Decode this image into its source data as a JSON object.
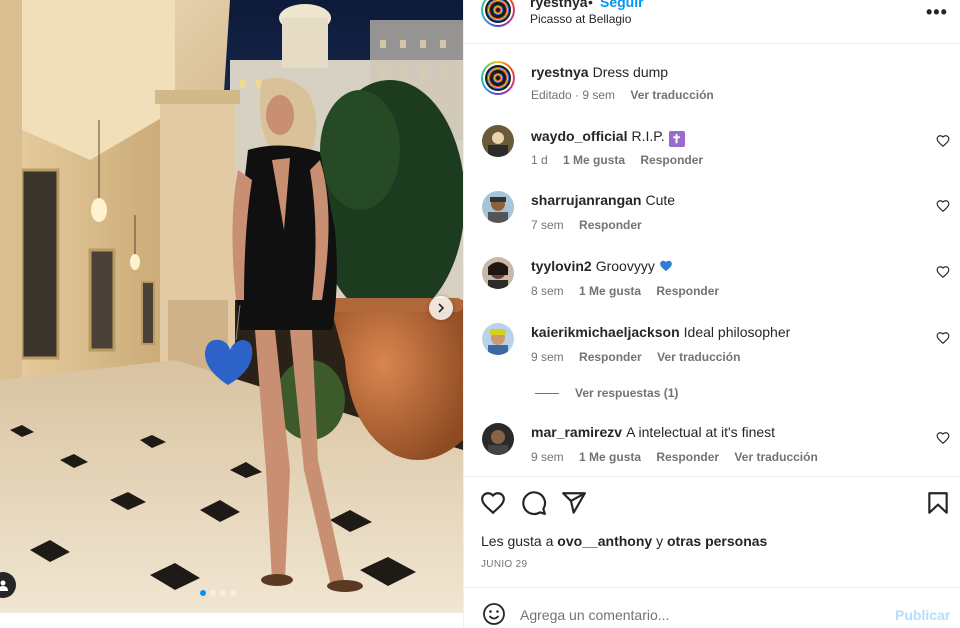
{
  "post": {
    "author": "ryestnya",
    "separator": "•",
    "follow_label": "Seguir",
    "location": "Picasso at Bellagio",
    "more_label": "•••"
  },
  "caption": {
    "user": "ryestnya",
    "text": "Dress dump",
    "edited": "Editado · 9 sem",
    "translate": "Ver traducción"
  },
  "comments": [
    {
      "user": "waydo_official",
      "text": "R.I.P.",
      "badge": "✝",
      "time": "1 d",
      "likes": "1 Me gusta",
      "reply": "Responder",
      "translate": ""
    },
    {
      "user": "sharrujanrangan",
      "text": "Cute",
      "time": "7 sem",
      "likes": "",
      "reply": "Responder",
      "translate": ""
    },
    {
      "user": "tyylovin2",
      "text": "Groovyyy",
      "time": "8 sem",
      "likes": "1 Me gusta",
      "reply": "Responder",
      "translate": ""
    },
    {
      "user": "kaierikmichaeljackson",
      "text": "Ideal philosopher",
      "time": "9 sem",
      "likes": "",
      "reply": "Responder",
      "translate": "Ver traducción"
    },
    {
      "user": "mar_ramirezv",
      "text": "A intelectual at it's finest",
      "time": "9 sem",
      "likes": "1 Me gusta",
      "reply": "Responder",
      "translate": "Ver traducción"
    }
  ],
  "view_replies": "Ver respuestas (1)",
  "likes": {
    "prefix": "Les gusta a",
    "user": "ovo__anthony",
    "joiner": "y",
    "others": "otras personas"
  },
  "date": "JUNIO 29",
  "composer": {
    "placeholder": "Agrega un comentario...",
    "publish": "Publicar"
  },
  "carousel": {
    "slides": 4,
    "active": 1
  },
  "colors": {
    "accent": "#0095f6",
    "publish_disabled": "#b2dffc",
    "muted": "#737373"
  }
}
